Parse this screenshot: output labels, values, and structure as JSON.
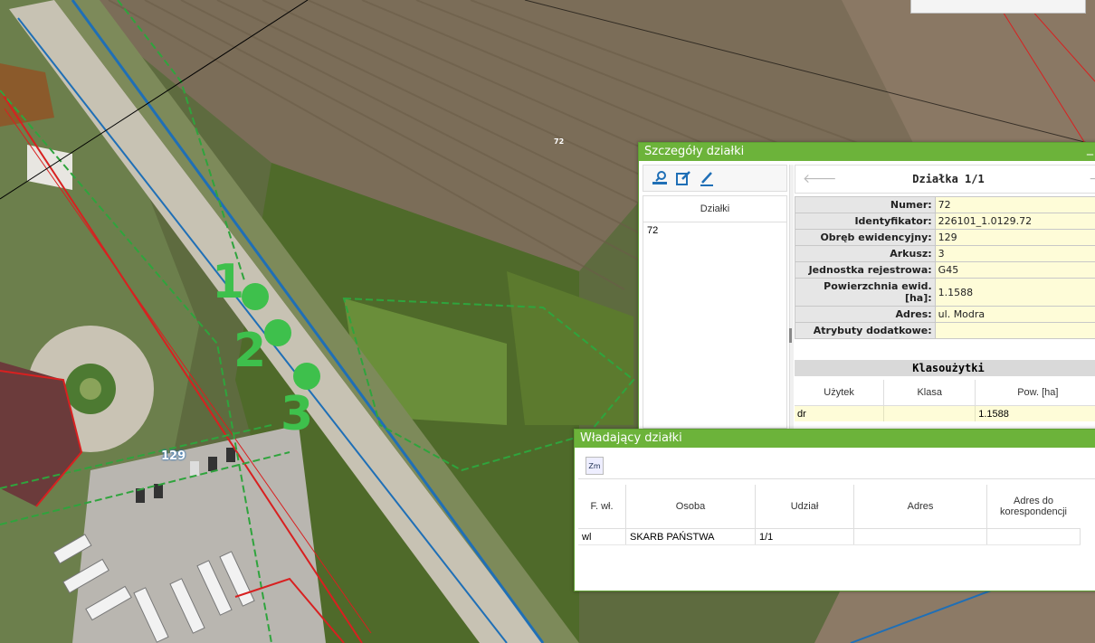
{
  "map": {
    "markers": [
      "1",
      "2",
      "3"
    ],
    "obreb_label": "129",
    "parcel_label": "72"
  },
  "details": {
    "title": "Szczegóły działki",
    "minimize": "_",
    "list_header": "Działki",
    "list_items": [
      "72"
    ],
    "nav_title": "Działka 1/1",
    "prev_arrow": "🡐",
    "next_arrow": "🡒",
    "properties": [
      {
        "key": "Numer:",
        "value": "72"
      },
      {
        "key": "Identyfikator:",
        "value": "226101_1.0129.72"
      },
      {
        "key": "Obręb ewidencyjny:",
        "value": "129"
      },
      {
        "key": "Arkusz:",
        "value": "3"
      },
      {
        "key": "Jednostka rejestrowa:",
        "value": "G45"
      },
      {
        "key": "Powierzchnia ewid. [ha]:",
        "value": "1.1588"
      },
      {
        "key": "Adres:",
        "value": "ul. Modra"
      },
      {
        "key": "Atrybuty dodatkowe:",
        "value": ""
      }
    ],
    "klasouzytki": {
      "title": "Klasoużytki",
      "columns": [
        "Użytek",
        "Klasa",
        "Pow. [ha]"
      ],
      "rows": [
        [
          "dr",
          "",
          "1.1588"
        ]
      ]
    }
  },
  "owners": {
    "title": "Władający działki",
    "toolbar_btn": "Zm",
    "columns": [
      "F. wł.",
      "Osoba",
      "Udział",
      "Adres",
      "Adres do korespondencji"
    ],
    "rows": [
      [
        "wl",
        "SKARB PAŃSTWA",
        "1/1",
        "",
        ""
      ]
    ]
  },
  "colors": {
    "title_bar": "#6cb33a",
    "value_bg": "#fefcd8",
    "key_bg": "#e6e6e6",
    "marker": "#3ec04c"
  }
}
